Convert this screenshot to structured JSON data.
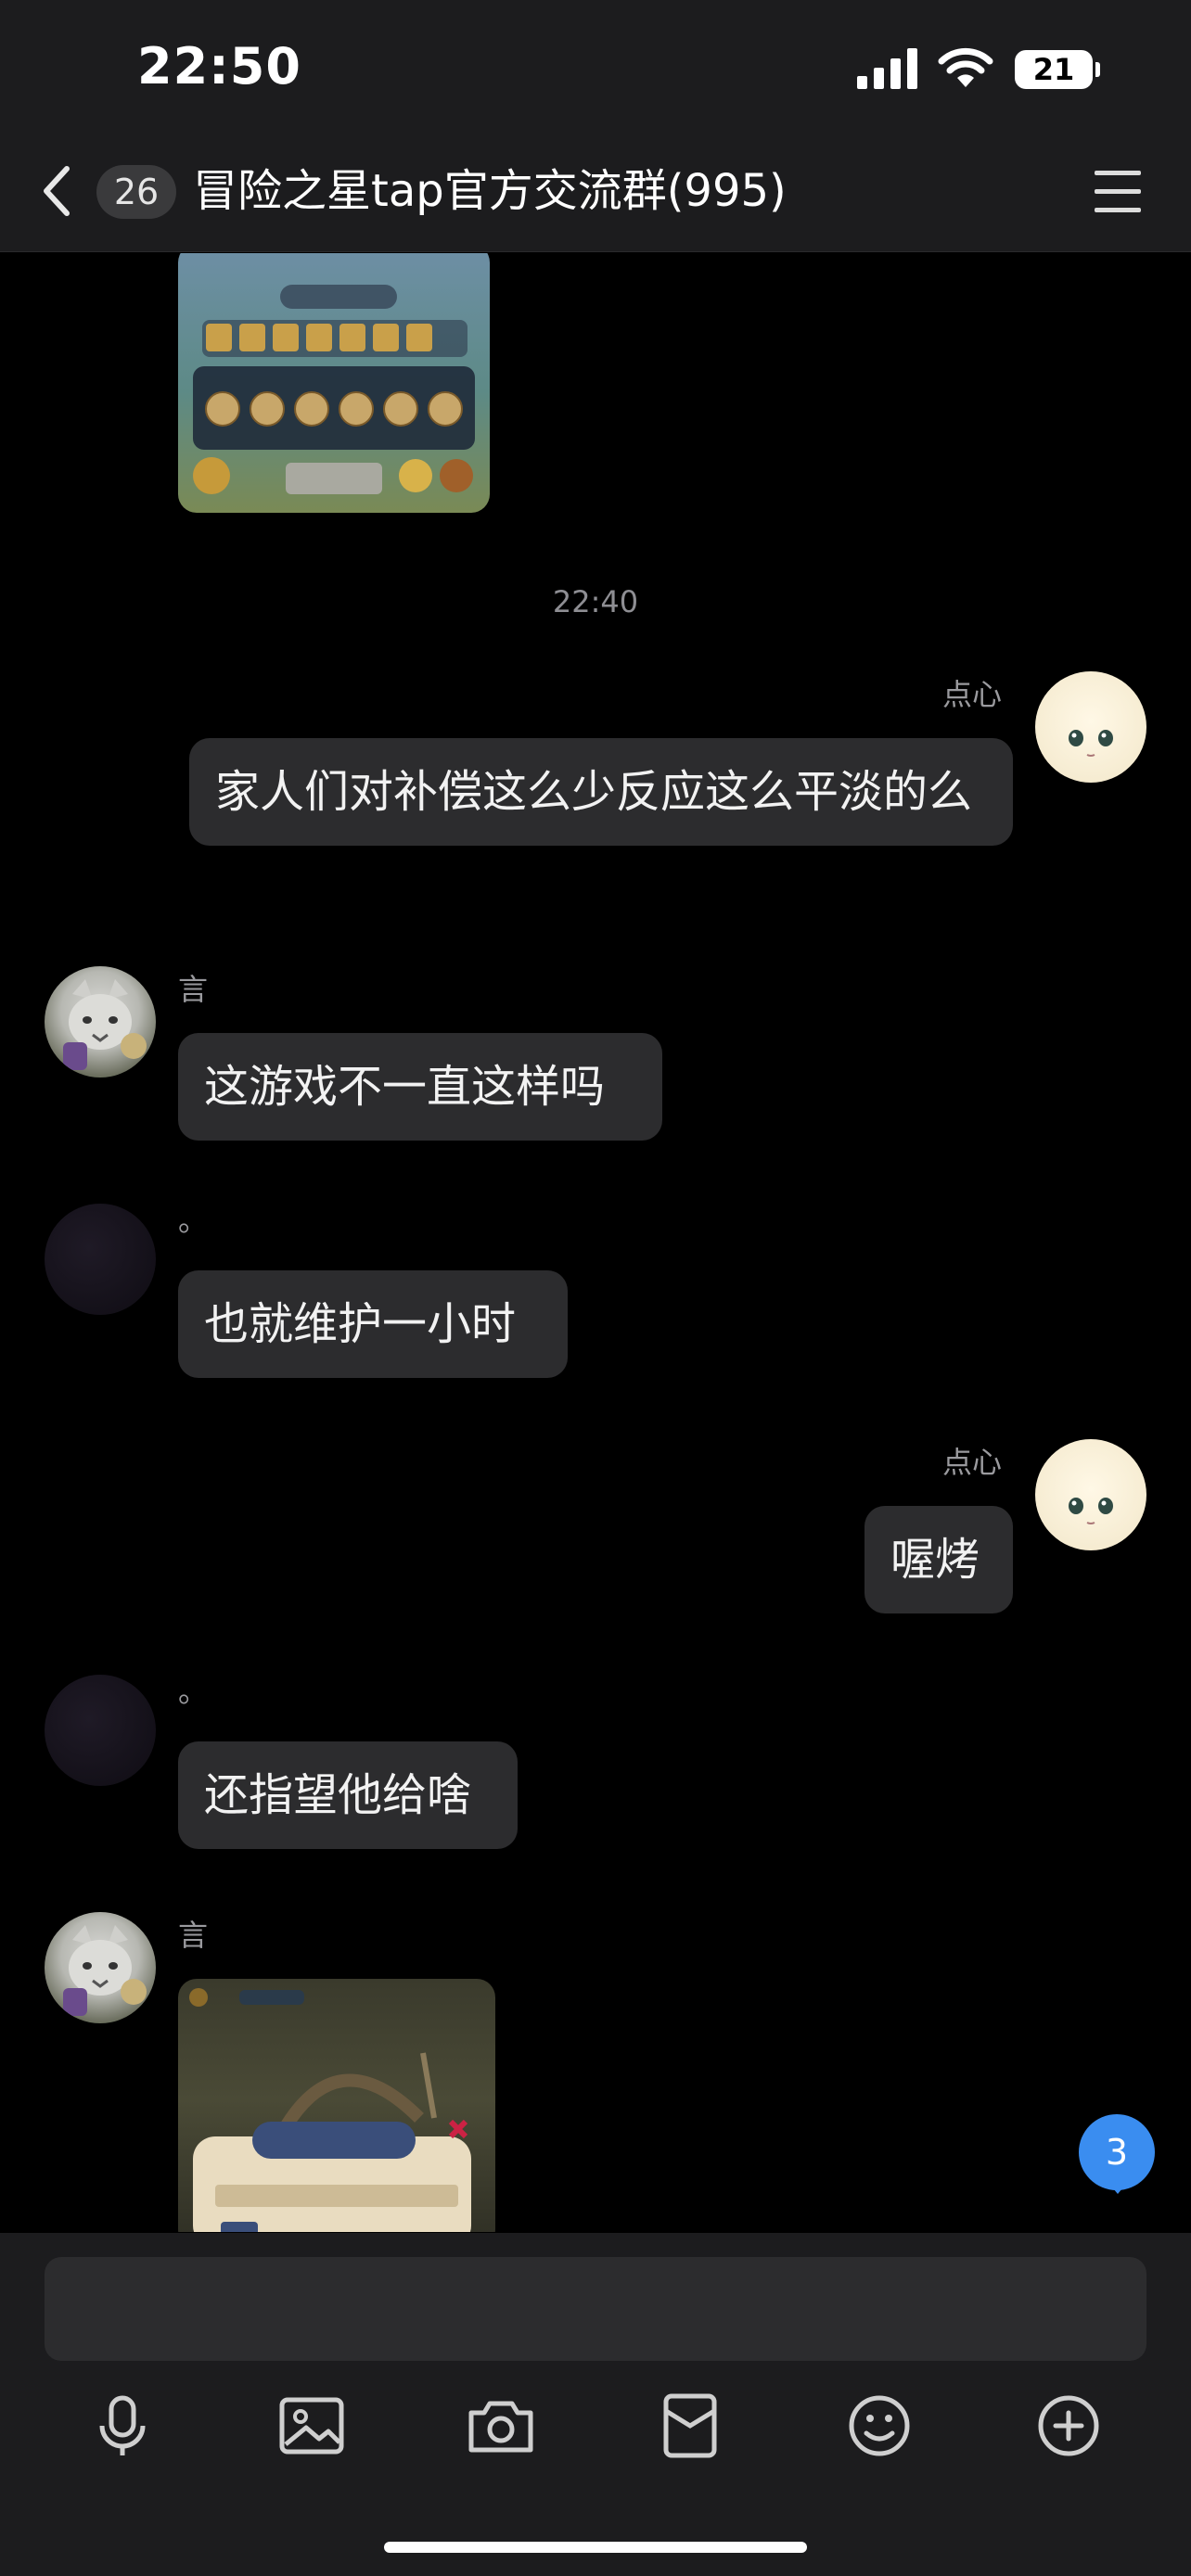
{
  "status_bar": {
    "time": "22:50",
    "battery": "21"
  },
  "header": {
    "unread_count": "26",
    "title": "冒险之星tap官方交流群(995)"
  },
  "chat": {
    "timestamp": "22:40",
    "messages": [
      {
        "sender": "点心",
        "text": "家人们对补偿这么少反应这么平淡的么"
      },
      {
        "sender": "言",
        "text": "这游戏不一直这样吗"
      },
      {
        "sender": "。",
        "text": "也就维护一小时"
      },
      {
        "sender": "点心",
        "text": "喔烤"
      },
      {
        "sender": "。",
        "text": "还指望他给啥"
      },
      {
        "sender": "言",
        "image": "game-screenshot"
      }
    ],
    "new_messages_badge": "3"
  },
  "toolbar": {
    "items": [
      "microphone-icon",
      "image-icon",
      "camera-icon",
      "red-packet-icon",
      "emoji-icon",
      "plus-icon"
    ]
  },
  "theme": {
    "background": "#000000",
    "bar": "#1c1c1e",
    "bubble": "#2c2c2e",
    "accent": "#3a8df0"
  }
}
